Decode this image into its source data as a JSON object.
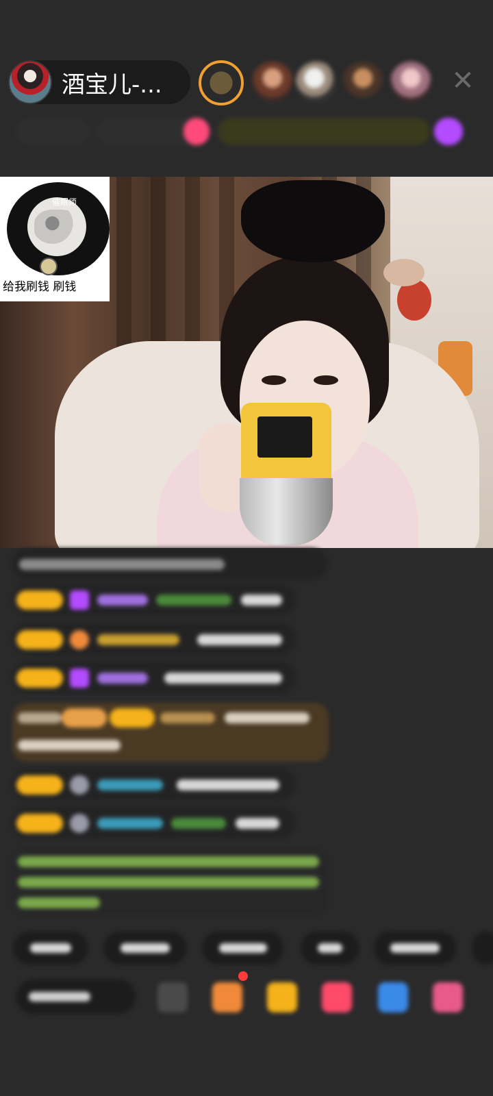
{
  "header": {
    "host_name": "酒宝儿-...",
    "close_icon": "close-icon"
  },
  "meme": {
    "top_text": "催眠师",
    "bottom_text": "给我刷钱 刷钱"
  },
  "colors": {
    "background": "#2a2a2b",
    "badge_gold": "#f5b21a",
    "gift_bg": "#4a3a24",
    "accent_pink": "#ff4a7a",
    "accent_purple": "#b34bff"
  }
}
